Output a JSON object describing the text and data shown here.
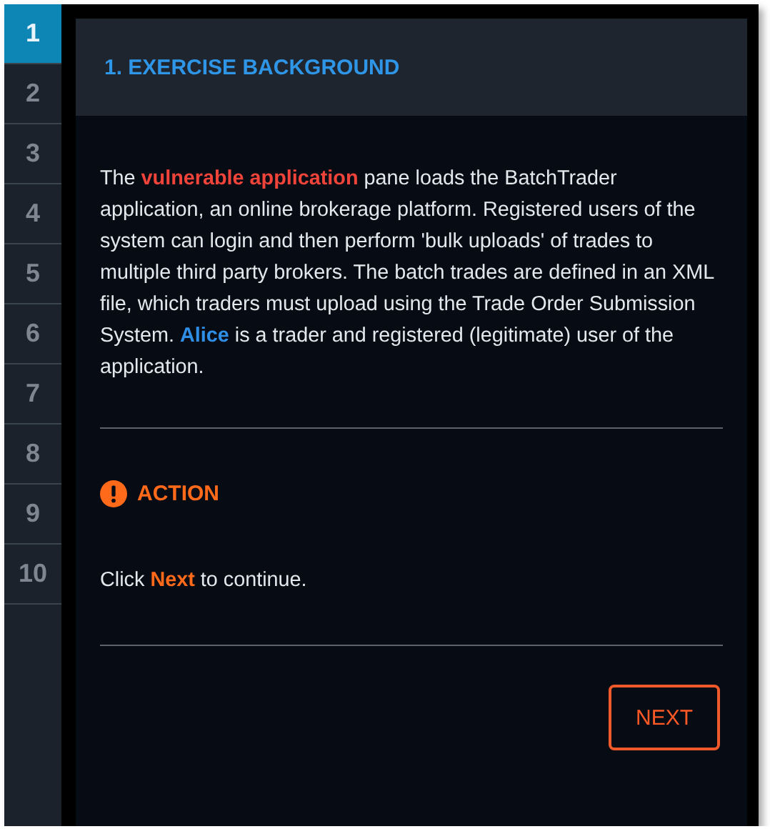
{
  "steps": [
    {
      "label": "1",
      "selected": true
    },
    {
      "label": "2",
      "selected": false
    },
    {
      "label": "3",
      "selected": false
    },
    {
      "label": "4",
      "selected": false
    },
    {
      "label": "5",
      "selected": false
    },
    {
      "label": "6",
      "selected": false
    },
    {
      "label": "7",
      "selected": false
    },
    {
      "label": "8",
      "selected": false
    },
    {
      "label": "9",
      "selected": false
    },
    {
      "label": "10",
      "selected": false
    }
  ],
  "header": {
    "title": "1. EXERCISE BACKGROUND"
  },
  "background": [
    {
      "text": "The ",
      "kind": "plain"
    },
    {
      "text": "vulnerable application",
      "kind": "danger"
    },
    {
      "text": " pane loads the BatchTrader application, an online brokerage platform. Registered users of the system can login and then perform 'bulk uploads' of trades to multiple third party brokers. The batch trades are defined in an XML file, which traders must upload using the Trade Order Submission System. ",
      "kind": "plain"
    },
    {
      "text": "Alice",
      "kind": "person"
    },
    {
      "text": " is a trader and registered (legitimate) user of the application.",
      "kind": "plain"
    }
  ],
  "action": {
    "title": "ACTION",
    "instruction": [
      {
        "text": "Click ",
        "kind": "plain"
      },
      {
        "text": "Next",
        "kind": "action"
      },
      {
        "text": " to continue.",
        "kind": "plain"
      }
    ]
  },
  "buttons": [
    {
      "label": "NEXT"
    }
  ]
}
